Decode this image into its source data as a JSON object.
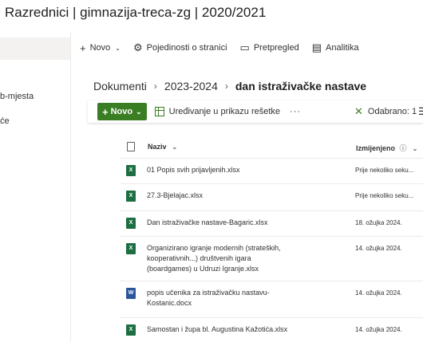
{
  "site": {
    "title": "Razrednici | gimnazija-treca-zg | 2020/2021"
  },
  "leftnav": {
    "items": [
      "b-mjesta",
      "će"
    ]
  },
  "commands": [
    {
      "icon": "plus-icon",
      "label": "Novo"
    },
    {
      "icon": "gear-icon",
      "label": "Pojedinosti o stranici"
    },
    {
      "icon": "preview-icon",
      "label": "Pretpregled"
    },
    {
      "icon": "analytics-icon",
      "label": "Analitika"
    }
  ],
  "breadcrumb": {
    "root": "Dokumenti",
    "mid": "2023-2024",
    "current": "dan istraživačke nastave"
  },
  "toolbar": {
    "new_label": "Novo",
    "grid_edit_label": "Uređivanje u prikazu rešetke",
    "more": "···",
    "selected_label": "Odabrano: 1"
  },
  "table": {
    "col_name": "Naziv",
    "col_modified": "Izmijenjeno",
    "rows": [
      {
        "type": "xlsx",
        "name": "01 Popis svih prijavljenih.xlsx",
        "modified": "Prije nekoliko seku..."
      },
      {
        "type": "xlsx",
        "name": "27.3-Bjelajac.xlsx",
        "modified": "Prije nekoliko seku..."
      },
      {
        "type": "xlsx",
        "name": "Dan istraživačke nastave-Bagaric.xlsx",
        "modified": "18. ožujka 2024."
      },
      {
        "type": "xlsx",
        "name": "Organizirano igranje modernih (strateških, kooperativnih...) društvenih igara (boardgames) u Udruzi Igranje.xlsx",
        "modified": "14. ožujka 2024."
      },
      {
        "type": "docx",
        "name": "popis učenika za istraživačku nastavu-Kostanic.docx",
        "modified": "14. ožujka 2024."
      },
      {
        "type": "xlsx",
        "name": "Samostan i župa bl. Augustina Kažotića.xlsx",
        "modified": "14. ožujka 2024."
      }
    ]
  },
  "colors": {
    "accent": "#3a7d23",
    "excel": "#1d6f42",
    "word": "#2b579a"
  }
}
